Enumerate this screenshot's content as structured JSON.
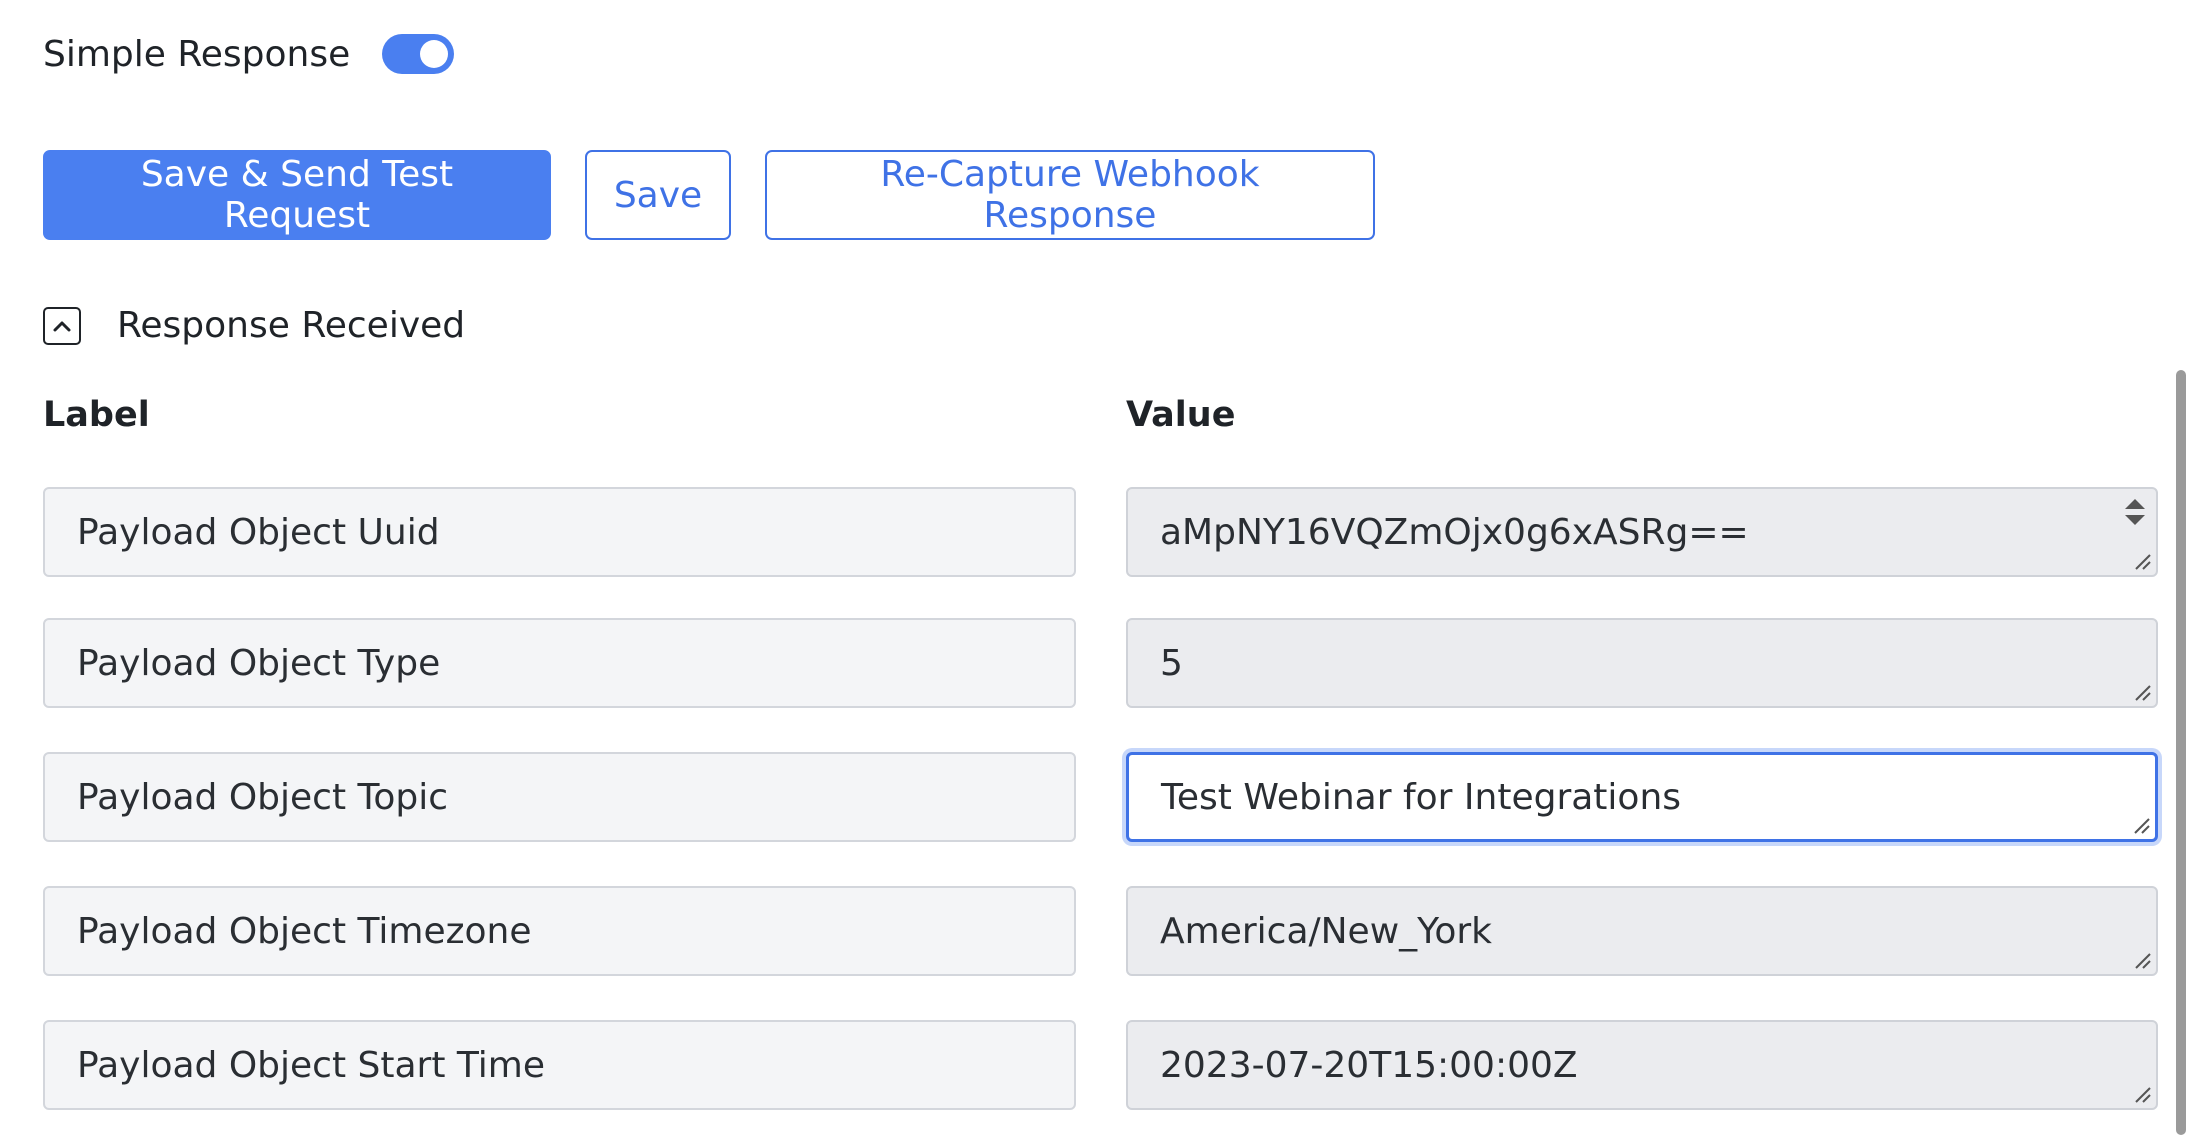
{
  "simple_response": {
    "label": "Simple Response",
    "enabled": true
  },
  "buttons": {
    "save_send": "Save & Send Test Request",
    "save": "Save",
    "recapture": "Re-Capture Webhook Response"
  },
  "response": {
    "title": "Response Received",
    "expanded": true
  },
  "table": {
    "label_header": "Label",
    "value_header": "Value",
    "rows": [
      {
        "label": "Payload Object Uuid",
        "value": "aMpNY16VQZmOjx0g6xASRg=="
      },
      {
        "label": "Payload Object Type",
        "value": "5"
      },
      {
        "label": "Payload Object Topic",
        "value": "Test Webinar for Integrations"
      },
      {
        "label": "Payload Object Timezone",
        "value": "America/New_York"
      },
      {
        "label": "Payload Object Start Time",
        "value": "2023-07-20T15:00:00Z"
      }
    ]
  },
  "colors": {
    "accent": "#4a7ff0",
    "outline": "#3f72e6"
  }
}
